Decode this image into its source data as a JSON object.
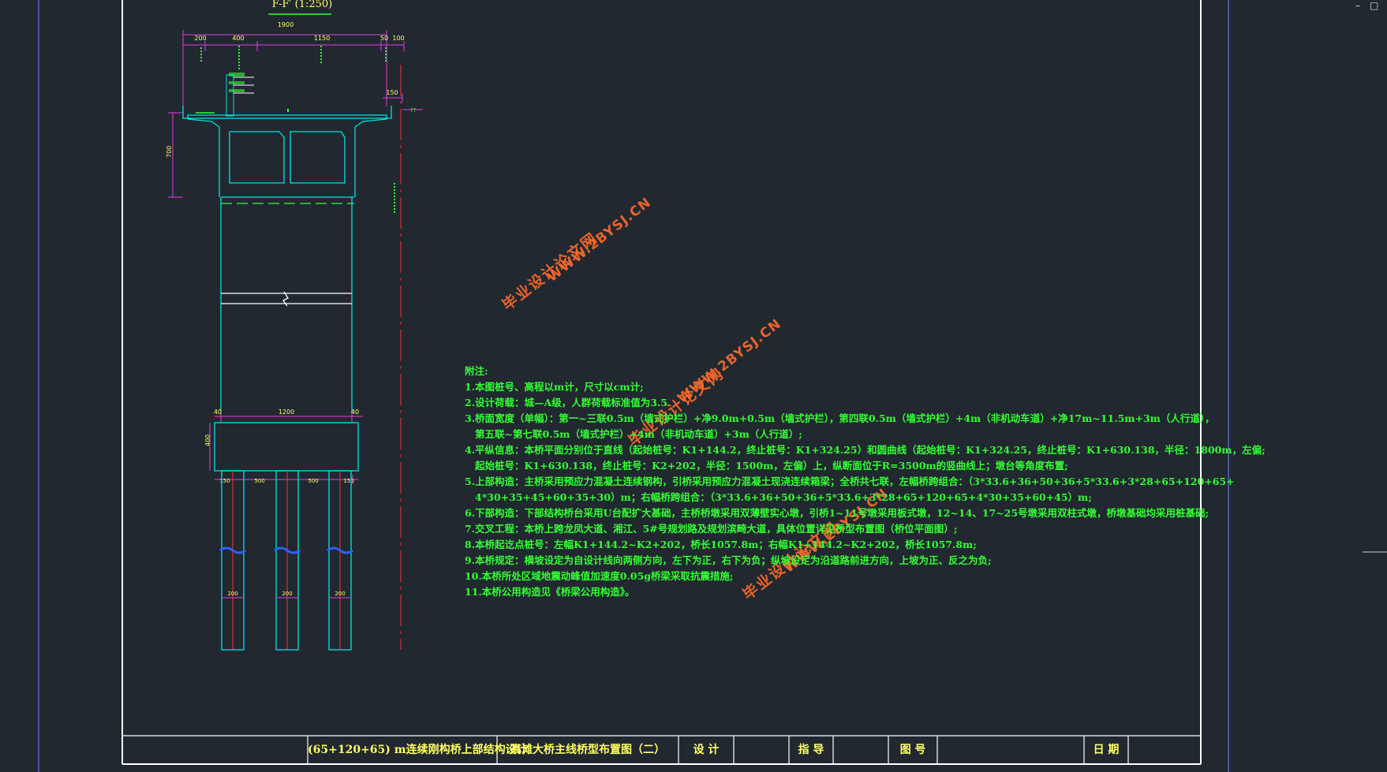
{
  "section_title": "F-F′ (1:250)",
  "dims": {
    "top_total": "1900",
    "top_segments": [
      "200",
      "400",
      "1150",
      "50",
      "100"
    ],
    "deck_right": "150",
    "deck_right_label": "??",
    "deck_left_height": "700",
    "pier_top": [
      "40",
      "1200",
      "40"
    ],
    "pile_cap_height": "400",
    "pile_spacing": [
      "150",
      "500",
      "500",
      "150"
    ],
    "pile_dia": [
      "200",
      "200",
      "200"
    ]
  },
  "notes_title": "附注:",
  "notes": [
    "1.本图桩号、高程以m计，尺寸以cm计;",
    "2.设计荷载：城—A级，人群荷载标准值为3.5",
    "3.桥面宽度（单幅）：第一~三联0.5m（墙式护栏）+净9.0m+0.5m（墙式护栏），第四联0.5m（墙式护栏）+4m（非机动车道）+净17m~11.5m+3m（人行道），",
    "   第五联~第七联0.5m（墙式护栏）+4m（非机动车道）+3m（人行道）;",
    "4.平纵信息：本桥平面分别位于直线（起始桩号：K1+144.2，终止桩号：K1+324.25）和圆曲线（起始桩号：K1+324.25，终止桩号：K1+630.138，半径：1800m，左偏;",
    "   起始桩号：K1+630.138，终止桩号：K2+202，半径：1500m，左偏）上，纵断面位于R=3500m的竖曲线上；墩台等角度布置;",
    "5.上部构造：主桥采用预应力混凝土连续钢构，引桥采用预应力混凝土现浇连续箱梁；全桥共七联，左幅桥跨组合：（3*33.6+36+50+36+5*33.6+3*28+65+120+65+",
    "   4*30+35+45+60+35+30）m；右幅桥跨组合：（3*33.6+36+50+36+5*33.6+3*28+65+120+65+4*30+35+60+45）m;",
    "6.下部构造：下部结构桥台采用U台配扩大基础，主桥桥墩采用双薄壁实心墩，引桥1~11号墩采用板式墩，12~14、17~25号墩采用双柱式墩，桥墩基础均采用桩基础;",
    "7.交叉工程：本桥上跨龙凤大道、湘江、5#号规划路及规划滨畸大道，具体位置详见桥型布置图（桥位平面图）;",
    "8.本桥起讫点桩号：左幅K1+144.2~K2+202，桥长1057.8m；右幅K1+144.2~K2+202，桥长1057.8m;",
    "9.本桥规定：横坡设定为自设计线向两侧方向，左下为正，右下为负；纵坡设定为沿道路前进方向，上坡为正、反之为负;",
    "10.本桥所处区域地震动峰值加速度0.05g桥梁采取抗震措施;",
    "11.本桥公用构造见《桥梁公用构造》。"
  ],
  "title_block": {
    "project": "(65+120+65) m连续刚构桥上部结构设计",
    "drawing": "高滩大桥主线桥型布置图（二）",
    "design_label": "设 计",
    "guide_label": "指 导",
    "drawing_no_label": "图 号",
    "date_label": "日 期"
  },
  "watermark": {
    "url": "WWW.2BYSJ.CN",
    "site": "毕业设计论文网"
  },
  "colors": {
    "background": "#212830",
    "frame": "#ffffff",
    "structure": "#00e5e5",
    "dimension": "#e040e0",
    "centerline": "#ff3030",
    "notes": "#33ff33",
    "titleblock_text": "#ffff66",
    "watermark": "#ff6a2a",
    "rebar": "#3060ff"
  }
}
